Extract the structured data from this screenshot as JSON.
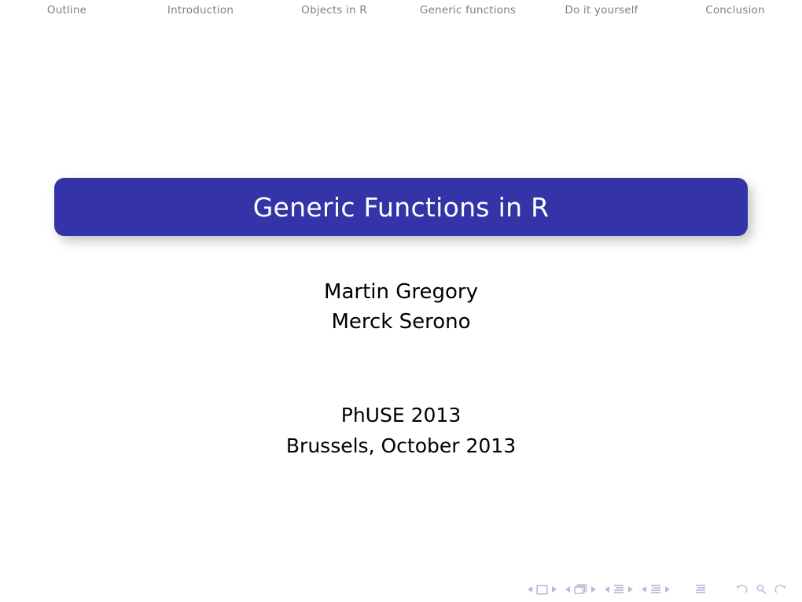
{
  "slide": {
    "background_color": "#ffffff",
    "accent_color": "#3433a8",
    "nav_text_color": "#808080",
    "nav_symbol_color": "#b9b9dd"
  },
  "nav_bar": {
    "items": [
      {
        "label": "Outline"
      },
      {
        "label": "Introduction"
      },
      {
        "label": "Objects in R"
      },
      {
        "label": "Generic functions"
      },
      {
        "label": "Do it yourself"
      },
      {
        "label": "Conclusion"
      }
    ]
  },
  "title": {
    "text": "Generic Functions in R"
  },
  "author": {
    "name": "Martin Gregory",
    "institute": "Merck Serono"
  },
  "event": {
    "conference": "PhUSE 2013",
    "location_date": "Brussels, October 2013"
  },
  "nav_symbols": {
    "groups": [
      {
        "name": "slide",
        "icon": "slide-icon",
        "prev_label": "previous-slide",
        "next_label": "next-slide"
      },
      {
        "name": "frame",
        "icon": "frame-icon",
        "prev_label": "previous-frame",
        "next_label": "next-frame"
      },
      {
        "name": "subsection",
        "icon": "subsection-icon",
        "prev_label": "previous-subsection",
        "next_label": "next-subsection"
      },
      {
        "name": "section",
        "icon": "section-icon",
        "prev_label": "previous-section",
        "next_label": "next-section"
      }
    ],
    "doc_icon": "document-icon",
    "back_icon": "back-arrow-icon",
    "search_icon": "search-icon",
    "forward_icon": "forward-arrow-icon"
  }
}
